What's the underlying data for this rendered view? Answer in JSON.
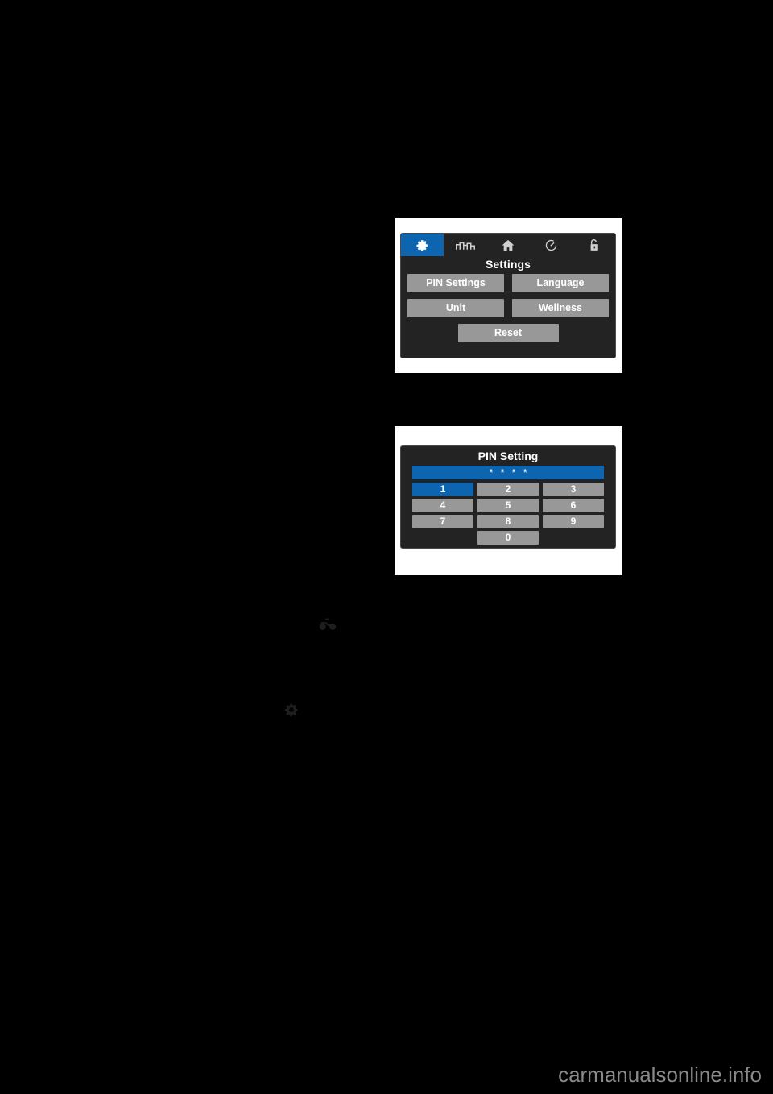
{
  "page": {
    "background": "#000000",
    "watermark": "carmanualsonline.info",
    "accent_blue": "#0d65b0",
    "button_gray": "#989898",
    "screen_bg": "#232323"
  },
  "settings_screen": {
    "title": "Settings",
    "tabs": [
      {
        "icon": "gear-icon",
        "active": true
      },
      {
        "icon": "trip-meter-icon",
        "active": false
      },
      {
        "icon": "home-icon",
        "active": false
      },
      {
        "icon": "gauge-icon",
        "active": false
      },
      {
        "icon": "unlocked-padlock-icon",
        "active": false
      }
    ],
    "buttons": [
      {
        "label": "PIN Settings"
      },
      {
        "label": "Language"
      },
      {
        "label": "Unit"
      },
      {
        "label": "Wellness"
      },
      {
        "label": "Reset"
      }
    ]
  },
  "pin_screen": {
    "title": "PIN Setting",
    "entry_mask": [
      "*",
      "*",
      "*",
      "*"
    ],
    "keys": [
      {
        "label": "1",
        "selected": true
      },
      {
        "label": "2",
        "selected": false
      },
      {
        "label": "3",
        "selected": false
      },
      {
        "label": "4",
        "selected": false
      },
      {
        "label": "5",
        "selected": false
      },
      {
        "label": "6",
        "selected": false
      },
      {
        "label": "7",
        "selected": false
      },
      {
        "label": "8",
        "selected": false
      },
      {
        "label": "9",
        "selected": false
      },
      {
        "label": "0",
        "selected": false
      }
    ]
  },
  "inline_icons": [
    {
      "name": "motorcycle-icon"
    },
    {
      "name": "gear-small-icon"
    }
  ]
}
